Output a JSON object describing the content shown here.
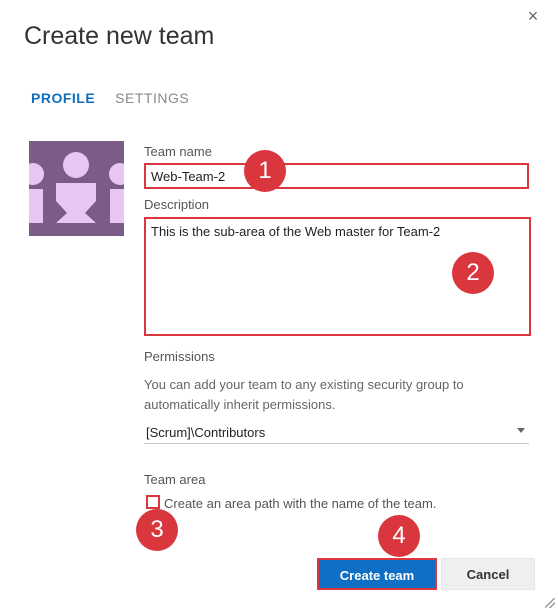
{
  "dialog": {
    "title": "Create new team",
    "close_label": "×"
  },
  "tabs": [
    {
      "label": "PROFILE",
      "active": true
    },
    {
      "label": "SETTINGS",
      "active": false
    }
  ],
  "fields": {
    "team_name_label": "Team name",
    "team_name_value": "Web-Team-2",
    "description_label": "Description",
    "description_value": "This is the sub-area of the Web master for Team-2",
    "permissions_label": "Permissions",
    "permissions_help": "You can add your team to any existing security group to automatically inherit permissions.",
    "permissions_selected": "[Scrum]\\Contributors",
    "team_area_label": "Team area",
    "team_area_checkbox_label": "Create an area path with the name of the team."
  },
  "buttons": {
    "create": "Create team",
    "cancel": "Cancel"
  },
  "annotations": [
    "1",
    "2",
    "3",
    "4"
  ],
  "colors": {
    "accent": "#106ebe",
    "primary_button": "#0e6fc4",
    "highlight": "#d9363e",
    "avatar_bg": "#7b5b87",
    "avatar_fg": "#e8c6f2"
  }
}
